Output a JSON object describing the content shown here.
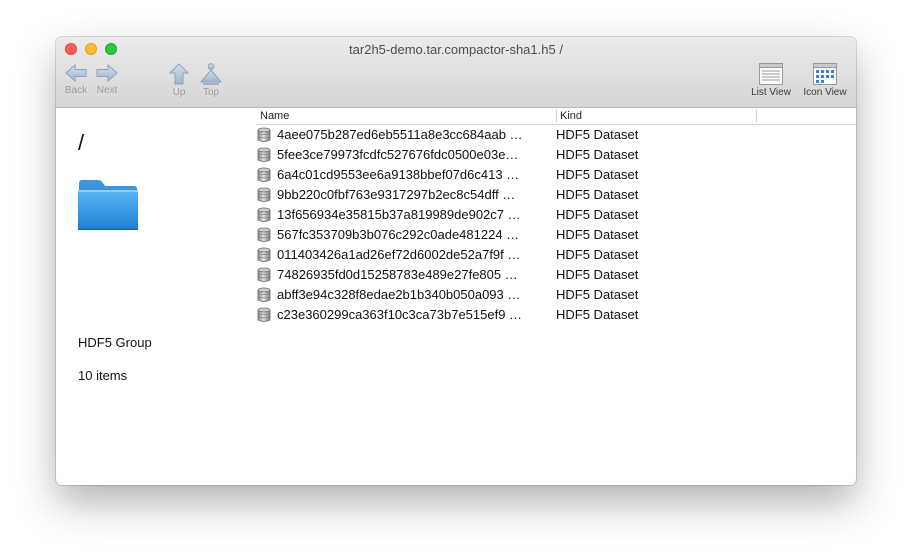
{
  "window": {
    "title": "tar2h5-demo.tar.compactor-sha1.h5 /"
  },
  "toolbar": {
    "back_label": "Back",
    "next_label": "Next",
    "up_label": "Up",
    "top_label": "Top",
    "list_view_label": "List View",
    "icon_view_label": "Icon View"
  },
  "sidebar": {
    "path": "/",
    "kind": "HDF5 Group",
    "count": "10 items",
    "icon": "folder-icon",
    "folder_color": "#3b9ee8"
  },
  "list": {
    "columns": {
      "name": "Name",
      "kind": "Kind"
    },
    "items": [
      {
        "name": "4aee075b287ed6eb5511a8e3cc684aab …",
        "kind": "HDF5 Dataset"
      },
      {
        "name": "5fee3ce79973fcdfc527676fdc0500e03e…",
        "kind": "HDF5 Dataset"
      },
      {
        "name": "6a4c01cd9553ee6a9138bbef07d6c413 …",
        "kind": "HDF5 Dataset"
      },
      {
        "name": "9bb220c0fbf763e9317297b2ec8c54dff …",
        "kind": "HDF5 Dataset"
      },
      {
        "name": "13f656934e35815b37a819989de902c7 …",
        "kind": "HDF5 Dataset"
      },
      {
        "name": "567fc353709b3b076c292c0ade481224 …",
        "kind": "HDF5 Dataset"
      },
      {
        "name": "011403426a1ad26ef72d6002de52a7f9f …",
        "kind": "HDF5 Dataset"
      },
      {
        "name": "74826935fd0d15258783e489e27fe805 …",
        "kind": "HDF5 Dataset"
      },
      {
        "name": "abff3e94c328f8edae2b1b340b050a093 …",
        "kind": "HDF5 Dataset"
      },
      {
        "name": "c23e360299ca363f10c3ca73b7e515ef9 …",
        "kind": "HDF5 Dataset"
      }
    ]
  }
}
